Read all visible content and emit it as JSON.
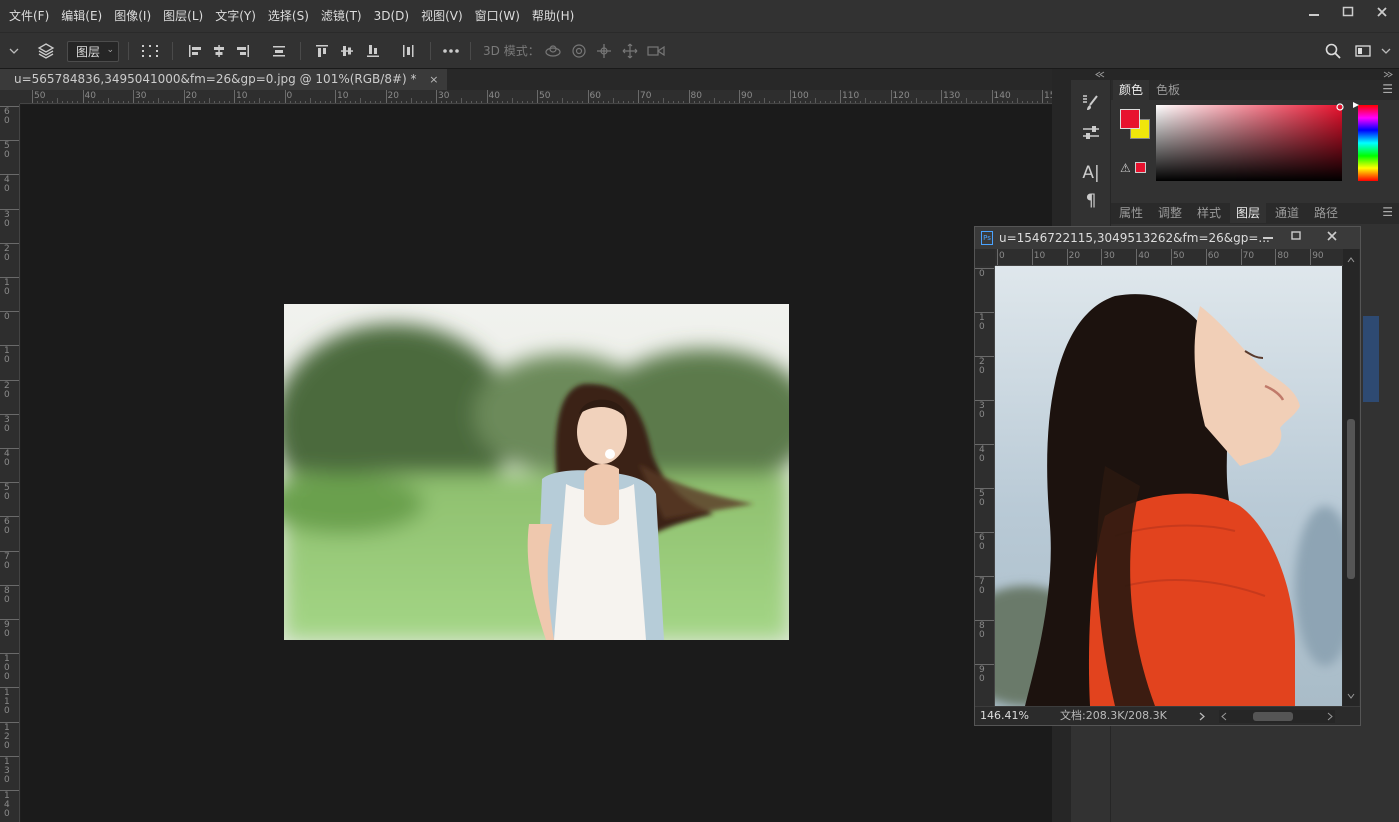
{
  "menu": {
    "items": [
      "文件(F)",
      "编辑(E)",
      "图像(I)",
      "图层(L)",
      "文字(Y)",
      "选择(S)",
      "滤镜(T)",
      "3D(D)",
      "视图(V)",
      "窗口(W)",
      "帮助(H)"
    ]
  },
  "options_bar": {
    "layer_select_value": "图层",
    "mode_3d_label": "3D 模式："
  },
  "document_tab": {
    "title": "u=565784836,3495041000&fm=26&gp=0.jpg @ 101%(RGB/8#) *",
    "close_glyph": "×"
  },
  "ruler": {
    "h_labels": [
      "50",
      "40",
      "30",
      "20",
      "10",
      "0",
      "10",
      "20",
      "30",
      "40",
      "50",
      "60",
      "70",
      "80",
      "90",
      "100",
      "110",
      "120",
      "130",
      "140",
      "15"
    ],
    "v_labels": [
      "6 0",
      "5 0",
      "4 0",
      "3 0",
      "2 0",
      "1 0",
      "0",
      "1 0",
      "2 0",
      "3 0",
      "4 0",
      "5 0",
      "6 0",
      "7 0",
      "8 0",
      "9 0",
      "1 0 0",
      "1 1 0",
      "1 2 0",
      "1 3 0",
      "1 4 0"
    ]
  },
  "color_panel": {
    "tabs": [
      "颜色",
      "色板"
    ],
    "active_tab": "颜色",
    "foreground_color": "#e8122e",
    "background_color": "#f0e60c"
  },
  "layers_panel": {
    "tabs": [
      "属性",
      "调整",
      "样式",
      "图层",
      "通道",
      "路径"
    ],
    "active_tab": "图层"
  },
  "floating_window": {
    "title": "u=1546722115,3049513262&fm=26&gp=...",
    "ruler_h_labels": [
      "0",
      "10",
      "20",
      "30",
      "40",
      "50",
      "60",
      "70",
      "80",
      "90"
    ],
    "ruler_v_labels": [
      "0",
      "1 0",
      "2 0",
      "3 0",
      "4 0",
      "5 0",
      "6 0",
      "7 0",
      "8 0",
      "9 0"
    ],
    "zoom": "146.41%",
    "doc_size": "文档:208.3K/208.3K"
  },
  "icons": [
    "layers-move-icon",
    "marquee-grid-icon",
    "align-left-icon",
    "align-hcenter-icon",
    "align-right-icon",
    "distribute-icon",
    "align-top-icon",
    "align-vcenter-icon",
    "align-bottom-icon",
    "more-icon",
    "3d-rotate-icon",
    "3d-roll-icon",
    "3d-pan-icon",
    "3d-slide-icon",
    "3d-scale-icon",
    "search-icon",
    "workspace-icon"
  ]
}
